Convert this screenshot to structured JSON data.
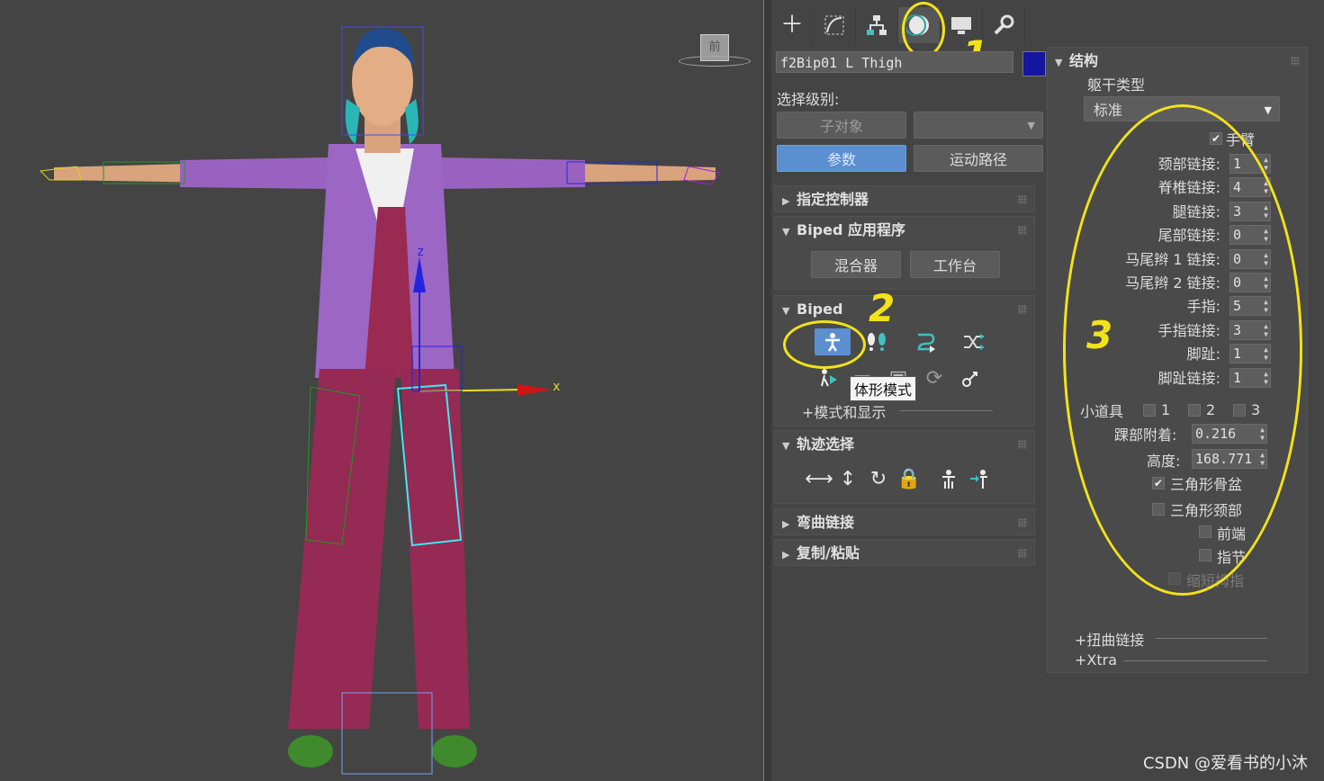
{
  "viewport": {
    "label": "前",
    "axis_x": "x",
    "axis_z": "z"
  },
  "toolbar": {
    "tabs": [
      {
        "name": "create",
        "icon": "plus-icon",
        "glyph": "＋"
      },
      {
        "name": "modify",
        "icon": "modify-curve-icon",
        "glyph": "⟋"
      },
      {
        "name": "hierarchy",
        "icon": "hierarchy-icon",
        "glyph": "⊤"
      },
      {
        "name": "motion",
        "icon": "motion-icon",
        "glyph": "◐"
      },
      {
        "name": "display",
        "icon": "display-icon",
        "glyph": "▬"
      },
      {
        "name": "utilities",
        "icon": "wrench-icon",
        "glyph": "🔧"
      }
    ]
  },
  "object": {
    "name": "f2Bip01 L Thigh",
    "color": "#1515a0"
  },
  "selection": {
    "label": "选择级别:",
    "sub_object": "子对象",
    "dropdown_value": "",
    "params": "参数",
    "motion_path": "运动路径"
  },
  "rollouts": {
    "assign_controller": "指定控制器",
    "biped_apps": "Biped 应用程序",
    "mixer": "混合器",
    "workbench": "工作台",
    "biped": "Biped",
    "modes_display": "+模式和显示",
    "track_selection": "轨迹选择",
    "bend_links": "弯曲链接",
    "copy_paste": "复制/粘贴"
  },
  "tooltip": "体形模式",
  "annotations": [
    "1",
    "2",
    "3"
  ],
  "structure": {
    "title": "结构",
    "torso_type_label": "躯干类型",
    "torso_type_value": "标准",
    "arms_label": "手臂",
    "arms_checked": true,
    "fields": [
      {
        "label": "颈部链接:",
        "value": "1"
      },
      {
        "label": "脊椎链接:",
        "value": "4"
      },
      {
        "label": "腿链接:",
        "value": "3"
      },
      {
        "label": "尾部链接:",
        "value": "0"
      },
      {
        "label": "马尾辫 1 链接:",
        "value": "0"
      },
      {
        "label": "马尾辫 2 链接:",
        "value": "0"
      },
      {
        "label": "手指:",
        "value": "5"
      },
      {
        "label": "手指链接:",
        "value": "3"
      },
      {
        "label": "脚趾:",
        "value": "1"
      },
      {
        "label": "脚趾链接:",
        "value": "1"
      }
    ],
    "props_label": "小道具",
    "props": [
      "1",
      "2",
      "3"
    ],
    "ankle_label": "踝部附着:",
    "ankle_value": "0.216",
    "height_label": "高度:",
    "height_value": "168.771",
    "tri_pelvis": "三角形骨盆",
    "tri_pelvis_checked": true,
    "tri_neck": "三角形颈部",
    "forefeet": "前端",
    "knuckles": "指节",
    "short_thumb": "缩短拇指",
    "twist_links": "+扭曲链接",
    "xtra": "+Xtra"
  },
  "watermark": "CSDN @爱看书的小沐",
  "colors": {
    "highlight": "#f2e21a",
    "primary_button": "#5b8fd0",
    "panel_bg": "#444444"
  }
}
